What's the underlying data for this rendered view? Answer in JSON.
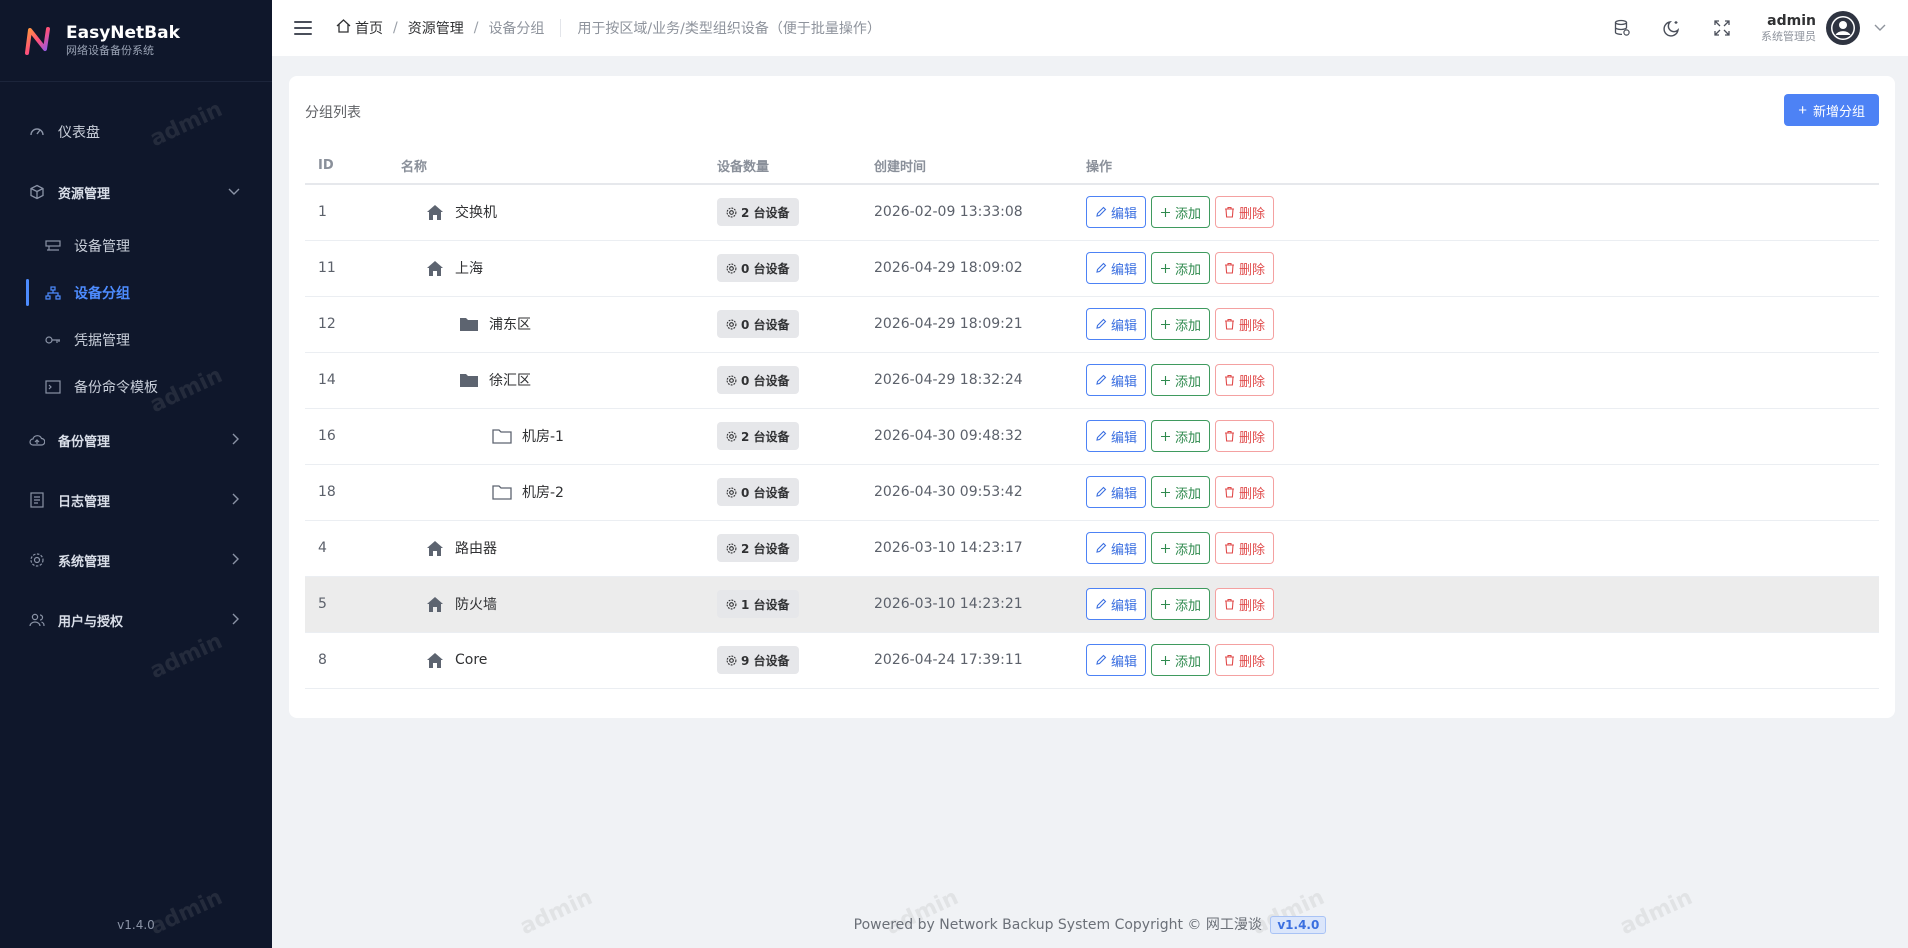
{
  "brand": {
    "name": "EasyNetBak",
    "subtitle": "网络设备备份系统",
    "version": "v1.4.0"
  },
  "sidebar": {
    "dashboard": "仪表盘",
    "resource_group": "资源管理",
    "resource_items": [
      "设备管理",
      "设备分组",
      "凭据管理",
      "备份命令模板"
    ],
    "backup_group": "备份管理",
    "log_group": "日志管理",
    "system_group": "系统管理",
    "user_group": "用户与授权"
  },
  "header": {
    "breadcrumb": [
      "首页",
      "资源管理",
      "设备分组"
    ],
    "description": "用于按区域/业务/类型组织设备（便于批量操作）",
    "user": {
      "name": "admin",
      "role": "系统管理员"
    }
  },
  "card": {
    "title": "分组列表",
    "add_button": "新增分组"
  },
  "table": {
    "columns": [
      "ID",
      "名称",
      "设备数量",
      "创建时间",
      "操作"
    ],
    "rows": [
      {
        "id": "1",
        "name": "交换机",
        "icon": "house-icon",
        "level": 0,
        "count": "2 台设备",
        "created": "2026-02-09 13:33:08"
      },
      {
        "id": "11",
        "name": "上海",
        "icon": "house-icon",
        "level": 0,
        "count": "0 台设备",
        "created": "2026-04-29 18:09:02"
      },
      {
        "id": "12",
        "name": "浦东区",
        "icon": "folder-filled-icon",
        "level": 1,
        "count": "0 台设备",
        "created": "2026-04-29 18:09:21"
      },
      {
        "id": "14",
        "name": "徐汇区",
        "icon": "folder-filled-icon",
        "level": 1,
        "count": "0 台设备",
        "created": "2026-04-29 18:32:24"
      },
      {
        "id": "16",
        "name": "机房-1",
        "icon": "folder-outline-icon",
        "level": 2,
        "count": "2 台设备",
        "created": "2026-04-30 09:48:32"
      },
      {
        "id": "18",
        "name": "机房-2",
        "icon": "folder-outline-icon",
        "level": 2,
        "count": "0 台设备",
        "created": "2026-04-30 09:53:42"
      },
      {
        "id": "4",
        "name": "路由器",
        "icon": "house-icon",
        "level": 0,
        "count": "2 台设备",
        "created": "2026-03-10 14:23:17"
      },
      {
        "id": "5",
        "name": "防火墙",
        "icon": "house-icon",
        "level": 0,
        "count": "1 台设备",
        "created": "2026-03-10 14:23:21"
      },
      {
        "id": "8",
        "name": "Core",
        "icon": "house-icon",
        "level": 0,
        "count": "9 台设备",
        "created": "2026-04-24 17:39:11"
      }
    ],
    "actions": {
      "edit": "编辑",
      "add": "添加",
      "delete": "删除"
    }
  },
  "footer": {
    "text": "Powered by Network Backup System Copyright © 网工漫谈",
    "version": "v1.4.0"
  },
  "watermark": "admin",
  "colors": {
    "sidebar_bg": "#0f172b",
    "accent": "#4d82f5",
    "add": "#3f9a5e",
    "danger": "#e04b4b"
  }
}
